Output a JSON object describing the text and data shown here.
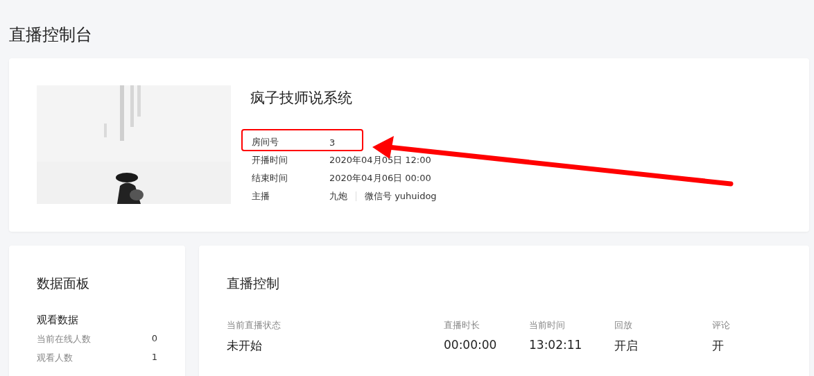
{
  "page_title": "直播控制台",
  "broadcast": {
    "title": "疯子技师说系统",
    "rows": [
      {
        "label": "房间号",
        "value": "3",
        "highlighted": true
      },
      {
        "label": "开播时间",
        "value": "2020年04月05日 12:00",
        "highlighted": false
      },
      {
        "label": "结束时间",
        "value": "2020年04月06日 00:00",
        "highlighted": false
      }
    ],
    "host": {
      "label": "主播",
      "name": "九炮",
      "wechat": "微信号 yuhuidog"
    }
  },
  "data_panel": {
    "title": "数据面板",
    "section": "观看数据",
    "rows": [
      {
        "label": "当前在线人数",
        "value": "0"
      },
      {
        "label": "观看人数",
        "value": "1"
      }
    ]
  },
  "live_control": {
    "title": "直播控制",
    "columns": [
      {
        "label": "当前直播状态",
        "value": "未开始"
      },
      {
        "label": "直播时长",
        "value": "00:00:00"
      },
      {
        "label": "当前时间",
        "value": "13:02:11"
      },
      {
        "label": "回放",
        "value": "开启"
      },
      {
        "label": "评论",
        "value": "开"
      }
    ]
  }
}
